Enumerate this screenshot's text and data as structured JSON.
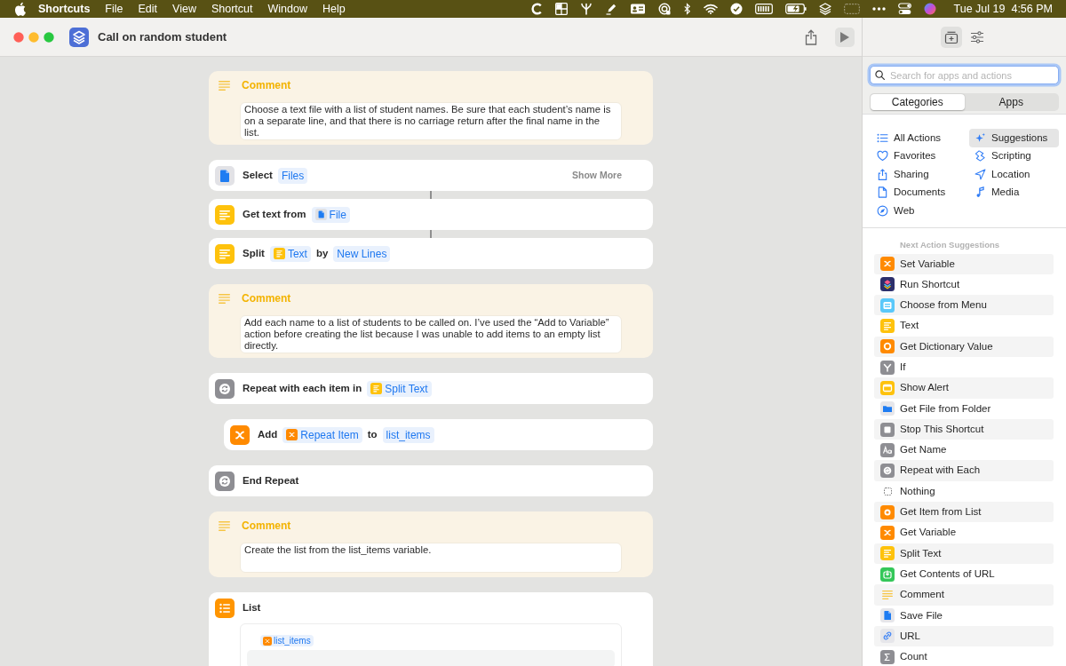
{
  "menu_bar": {
    "app_name": "Shortcuts",
    "menus": [
      "File",
      "Edit",
      "View",
      "Shortcut",
      "Window",
      "Help"
    ],
    "date": "Tue Jul 19",
    "time": "4:56 PM"
  },
  "window": {
    "title": "Call on random student"
  },
  "actions": [
    {
      "kind": "comment",
      "linked": false,
      "title": "Comment",
      "text": "Choose a text file with a list of student names. Be sure that each student’s name is on a separate line, and that there is no carriage return after the final name in the list."
    },
    {
      "kind": "files",
      "linked": false,
      "parts": [
        {
          "kind": "label",
          "text": "Select"
        },
        {
          "kind": "param",
          "text": "Files"
        }
      ],
      "show_more": "Show More"
    },
    {
      "kind": "text",
      "linked": true,
      "parts": [
        {
          "kind": "label",
          "text": "Get text from"
        },
        {
          "kind": "filevar",
          "text": "File"
        }
      ]
    },
    {
      "kind": "text",
      "linked": true,
      "parts": [
        {
          "kind": "label",
          "text": "Split"
        },
        {
          "kind": "textvar",
          "text": "Text"
        },
        {
          "kind": "label",
          "text": "by"
        },
        {
          "kind": "param",
          "text": "New Lines"
        }
      ]
    },
    {
      "kind": "comment",
      "linked": false,
      "title": "Comment",
      "text": "Add each name to a list of students to be called on. I’ve used the “Add to Variable” action before creating the list because I was unable to add items to an empty list directly."
    },
    {
      "kind": "repeat",
      "linked": false,
      "parts": [
        {
          "kind": "label",
          "text": "Repeat with each item in"
        },
        {
          "kind": "textvar",
          "text": "Split Text"
        }
      ],
      "children": [
        {
          "kind": "variable",
          "linked": false,
          "parts": [
            {
              "kind": "label",
              "text": "Add"
            },
            {
              "kind": "itemvar",
              "text": "Repeat Item"
            },
            {
              "kind": "label",
              "text": "to"
            },
            {
              "kind": "param",
              "text": "list_items"
            }
          ]
        }
      ]
    },
    {
      "kind": "repeat",
      "linked": false,
      "parts": [
        {
          "kind": "label",
          "text": "End Repeat"
        }
      ]
    },
    {
      "kind": "comment",
      "linked": false,
      "title": "Comment",
      "text": "Create the list from the list_items variable."
    },
    {
      "kind": "list",
      "linked": false,
      "parts": [
        {
          "kind": "label",
          "text": "List"
        }
      ],
      "items": [
        {
          "kind": "itemvar",
          "text": "list_items"
        }
      ]
    }
  ],
  "sidebar": {
    "toolbar": [
      {
        "selected": true
      },
      {
        "selected": false
      }
    ],
    "search": {
      "placeholder": "Search for apps and actions",
      "focused": true
    },
    "tabs": [
      {
        "label": "Categories",
        "selected": true
      },
      {
        "label": "Apps",
        "selected": false
      }
    ],
    "categories": [
      {
        "label": "All Actions",
        "selected": false
      },
      {
        "label": "Suggestions",
        "selected": true
      },
      {
        "label": "Favorites",
        "selected": false
      },
      {
        "label": "Scripting",
        "selected": false
      },
      {
        "label": "Sharing",
        "selected": false
      },
      {
        "label": "Location",
        "selected": false
      },
      {
        "label": "Documents",
        "selected": false
      },
      {
        "label": "Media",
        "selected": false
      },
      {
        "label": "Web",
        "selected": false
      }
    ],
    "suggestions": {
      "heading": "Next Action Suggestions",
      "items": [
        "Set Variable",
        "Run Shortcut",
        "Choose from Menu",
        "Text",
        "Get Dictionary Value",
        "If",
        "Show Alert",
        "Get File from Folder",
        "Stop This Shortcut",
        "Get Name",
        "Repeat with Each",
        "Nothing",
        "Get Item from List",
        "Get Variable",
        "Split Text",
        "Get Contents of URL",
        "Comment",
        "Save File",
        "URL",
        "Count"
      ]
    }
  }
}
